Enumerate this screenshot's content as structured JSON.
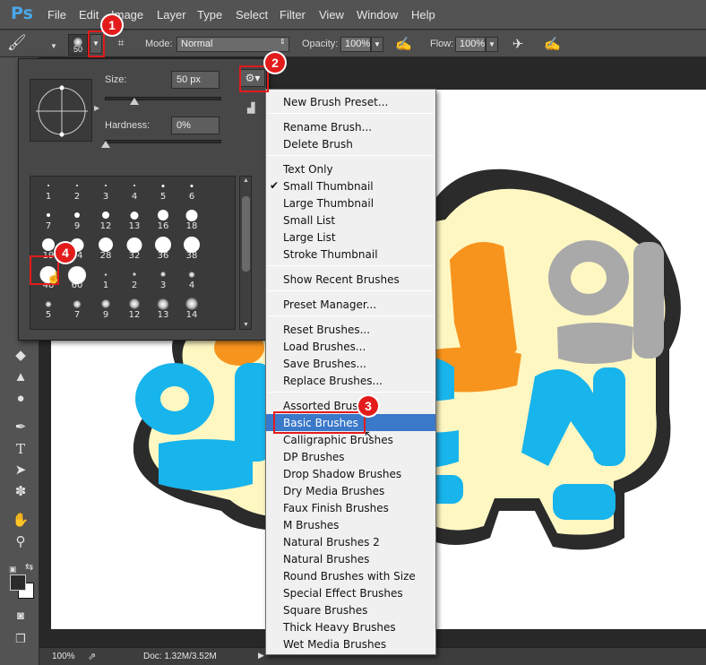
{
  "app": {
    "logo": "Ps"
  },
  "menubar": {
    "items": [
      "File",
      "Edit",
      "Image",
      "Layer",
      "Type",
      "Select",
      "Filter",
      "View",
      "Window",
      "Help"
    ]
  },
  "options": {
    "brush_size_value": "50",
    "mode_label": "Mode:",
    "mode_value": "Normal",
    "opacity_label": "Opacity:",
    "opacity_value": "100%",
    "flow_label": "Flow:",
    "flow_value": "100%"
  },
  "picker": {
    "size_label": "Size:",
    "size_value": "50 px",
    "hardness_label": "Hardness:",
    "hardness_value": "0%",
    "grid": [
      [
        "1",
        "2",
        "3",
        "4",
        "5",
        "6"
      ],
      [
        "7",
        "9",
        "12",
        "13",
        "16",
        "18"
      ],
      [
        "19",
        "24",
        "28",
        "32",
        "36",
        "38"
      ],
      [
        "48",
        "60",
        "1",
        "2",
        "3",
        "4"
      ],
      [
        "5",
        "7",
        "9",
        "12",
        "13",
        "14"
      ]
    ]
  },
  "menu": {
    "items": [
      "New Brush Preset...",
      "Rename Brush...",
      "Delete Brush",
      "Text Only",
      "Small Thumbnail",
      "Large Thumbnail",
      "Small List",
      "Large List",
      "Stroke Thumbnail",
      "Show Recent Brushes",
      "Preset Manager...",
      "Reset Brushes...",
      "Load Brushes...",
      "Save Brushes...",
      "Replace Brushes...",
      "Assorted Brushes",
      "Basic Brushes",
      "Calligraphic Brushes",
      "DP Brushes",
      "Drop Shadow Brushes",
      "Dry Media Brushes",
      "Faux Finish Brushes",
      "M Brushes",
      "Natural Brushes 2",
      "Natural Brushes",
      "Round Brushes with Size",
      "Special Effect Brushes",
      "Square Brushes",
      "Thick Heavy Brushes",
      "Wet Media Brushes"
    ],
    "checked_item": "Small Thumbnail",
    "selected_item": "Basic Brushes"
  },
  "status": {
    "zoom": "100%",
    "doc": "Doc: 1.32M/3.52M"
  },
  "callouts": [
    "1",
    "2",
    "3",
    "4"
  ],
  "colors": {
    "callout": "#e31b1b",
    "menu_highlight": "#3a78c9",
    "artwork_blue": "#18b4ec",
    "artwork_orange": "#f7941d",
    "artwork_gray": "#a9a9a9",
    "artwork_outline": "#2b2b2b",
    "artwork_cream": "#fff7c2"
  }
}
